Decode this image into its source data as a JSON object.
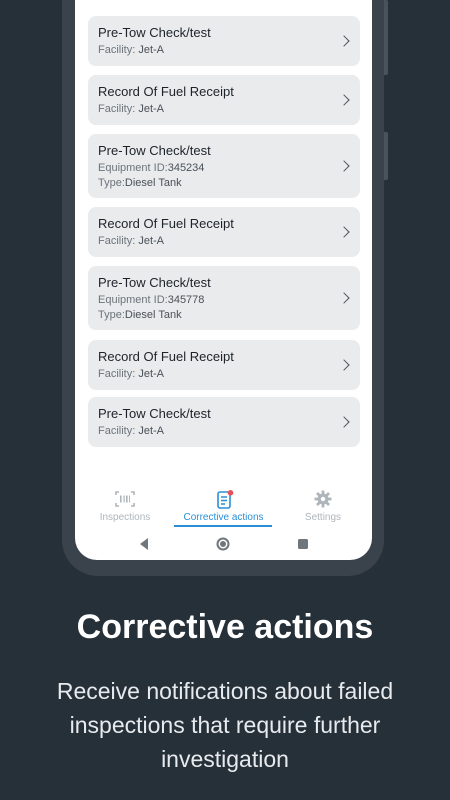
{
  "cards": [
    {
      "title": "Pre-Tow Check/test",
      "lines": [
        {
          "label": "Facility:",
          "value": "Jet-A"
        }
      ]
    },
    {
      "title": "Record Of Fuel Receipt",
      "lines": [
        {
          "label": "Facility:",
          "value": "Jet-A"
        }
      ]
    },
    {
      "title": "Pre-Tow Check/test",
      "lines": [
        {
          "label": "Equipment ID:",
          "value": "345234"
        },
        {
          "label": "Type:",
          "value": "Diesel Tank"
        }
      ]
    },
    {
      "title": "Record Of Fuel Receipt",
      "lines": [
        {
          "label": "Facility:",
          "value": "Jet-A"
        }
      ]
    },
    {
      "title": "Pre-Tow Check/test",
      "lines": [
        {
          "label": "Equipment ID:",
          "value": "345778"
        },
        {
          "label": "Type:",
          "value": "Diesel Tank"
        }
      ]
    },
    {
      "title": "Record Of Fuel Receipt",
      "lines": [
        {
          "label": "Facility:",
          "value": "Jet-A"
        }
      ]
    },
    {
      "title": "Pre-Tow Check/test",
      "lines": [
        {
          "label": "Facility:",
          "value": "Jet-A"
        }
      ]
    }
  ],
  "nav": {
    "inspections": "Inspections",
    "corrective": "Corrective actions",
    "settings": "Settings"
  },
  "colors": {
    "accent": "#2a8fd6",
    "badge": "#e8505b",
    "background": "#263039"
  },
  "icons": [
    "chevron-right-icon",
    "scan-icon",
    "clipboard-icon",
    "gear-icon",
    "back-icon",
    "home-icon",
    "recents-icon"
  ],
  "promo": {
    "headline": "Corrective actions",
    "description": "Receive notifications about failed inspections that require further investigation"
  }
}
